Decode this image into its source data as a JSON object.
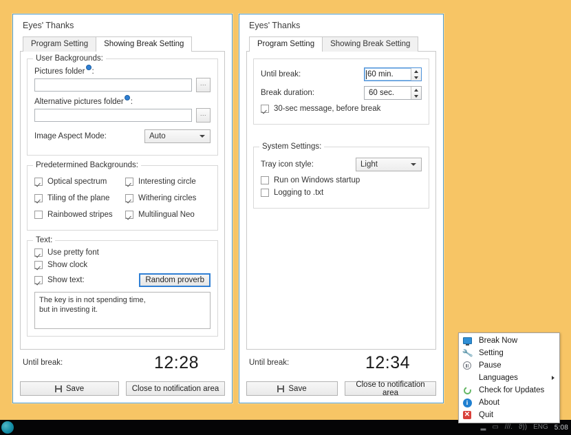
{
  "desktop": {
    "background_color": "#f7c565"
  },
  "taskbar": {
    "tray_glyphs": [
      "▬",
      "▂",
      "▭",
      "⼢",
      "⏵"
    ],
    "network_label": "///.",
    "volume_label": "ϑ))",
    "language": "ENG",
    "clock": "5:08"
  },
  "window_left": {
    "title": "Eyes' Thanks",
    "tabs": [
      {
        "label": "Program Setting",
        "active": false
      },
      {
        "label": "Showing Break Setting",
        "active": true
      }
    ],
    "groups": {
      "user_backgrounds": {
        "title": "User Backgrounds:",
        "pictures_folder_label": "Pictures folder",
        "pictures_folder_suffix": ":",
        "pictures_folder_value": "",
        "alt_folder_label": "Alternative pictures folder",
        "alt_folder_suffix": ":",
        "alt_folder_value": "",
        "browse_label": "...",
        "aspect_mode_label": "Image Aspect Mode:",
        "aspect_mode_value": "Auto"
      },
      "predetermined": {
        "title": "Predetermined Backgrounds:",
        "items": [
          {
            "label": "Optical spectrum",
            "checked": true
          },
          {
            "label": "Interesting circle",
            "checked": true
          },
          {
            "label": "Tiling of the plane",
            "checked": true
          },
          {
            "label": "Withering circles",
            "checked": true
          },
          {
            "label": "Rainbowed stripes",
            "checked": false
          },
          {
            "label": "Multilingual Neo",
            "checked": true
          }
        ]
      },
      "text": {
        "title": "Text:",
        "items": [
          {
            "label": "Use pretty font",
            "checked": true
          },
          {
            "label": "Show clock",
            "checked": true
          }
        ],
        "show_text_label": "Show text:",
        "show_text_checked": true,
        "random_proverb_label": "Random proverb",
        "proverb_value": "The key is in not spending time,\nbut in investing it."
      }
    },
    "footer": {
      "until_break_label": "Until break:",
      "clock": "12:28",
      "save_label": "Save",
      "close_label": "Close to notification area"
    }
  },
  "window_right": {
    "title": "Eyes' Thanks",
    "tabs": [
      {
        "label": "Program Setting",
        "active": true
      },
      {
        "label": "Showing Break Setting",
        "active": false
      }
    ],
    "groups": {
      "break": {
        "until_break_label": "Until break:",
        "until_break_value": "60 min.",
        "break_duration_label": "Break duration:",
        "break_duration_value": "60 sec.",
        "message_label": "30-sec message, before break",
        "message_checked": true
      },
      "system": {
        "title": "System Settings:",
        "tray_icon_label": "Tray icon style:",
        "tray_icon_value": "Light",
        "startup_label": "Run on Windows startup",
        "startup_checked": false,
        "logging_label": "Logging to .txt",
        "logging_checked": false
      }
    },
    "footer": {
      "until_break_label": "Until break:",
      "clock": "12:34",
      "save_label": "Save",
      "close_label": "Close to notification area"
    }
  },
  "tray_menu": {
    "items": [
      {
        "label": "Break Now",
        "icon": "monitor-icon",
        "submenu": false
      },
      {
        "label": "Setting",
        "icon": "wrench-icon",
        "submenu": false
      },
      {
        "label": "Pause",
        "icon": "pause-icon",
        "submenu": false
      },
      {
        "label": "Languages",
        "icon": "none",
        "submenu": true
      },
      {
        "label": "Check for Updates",
        "icon": "refresh-icon",
        "submenu": false
      },
      {
        "label": "About",
        "icon": "info-icon",
        "submenu": false
      },
      {
        "label": "Quit",
        "icon": "close-icon",
        "submenu": false
      }
    ],
    "info_glyph": "i",
    "quit_glyph": "✕"
  }
}
